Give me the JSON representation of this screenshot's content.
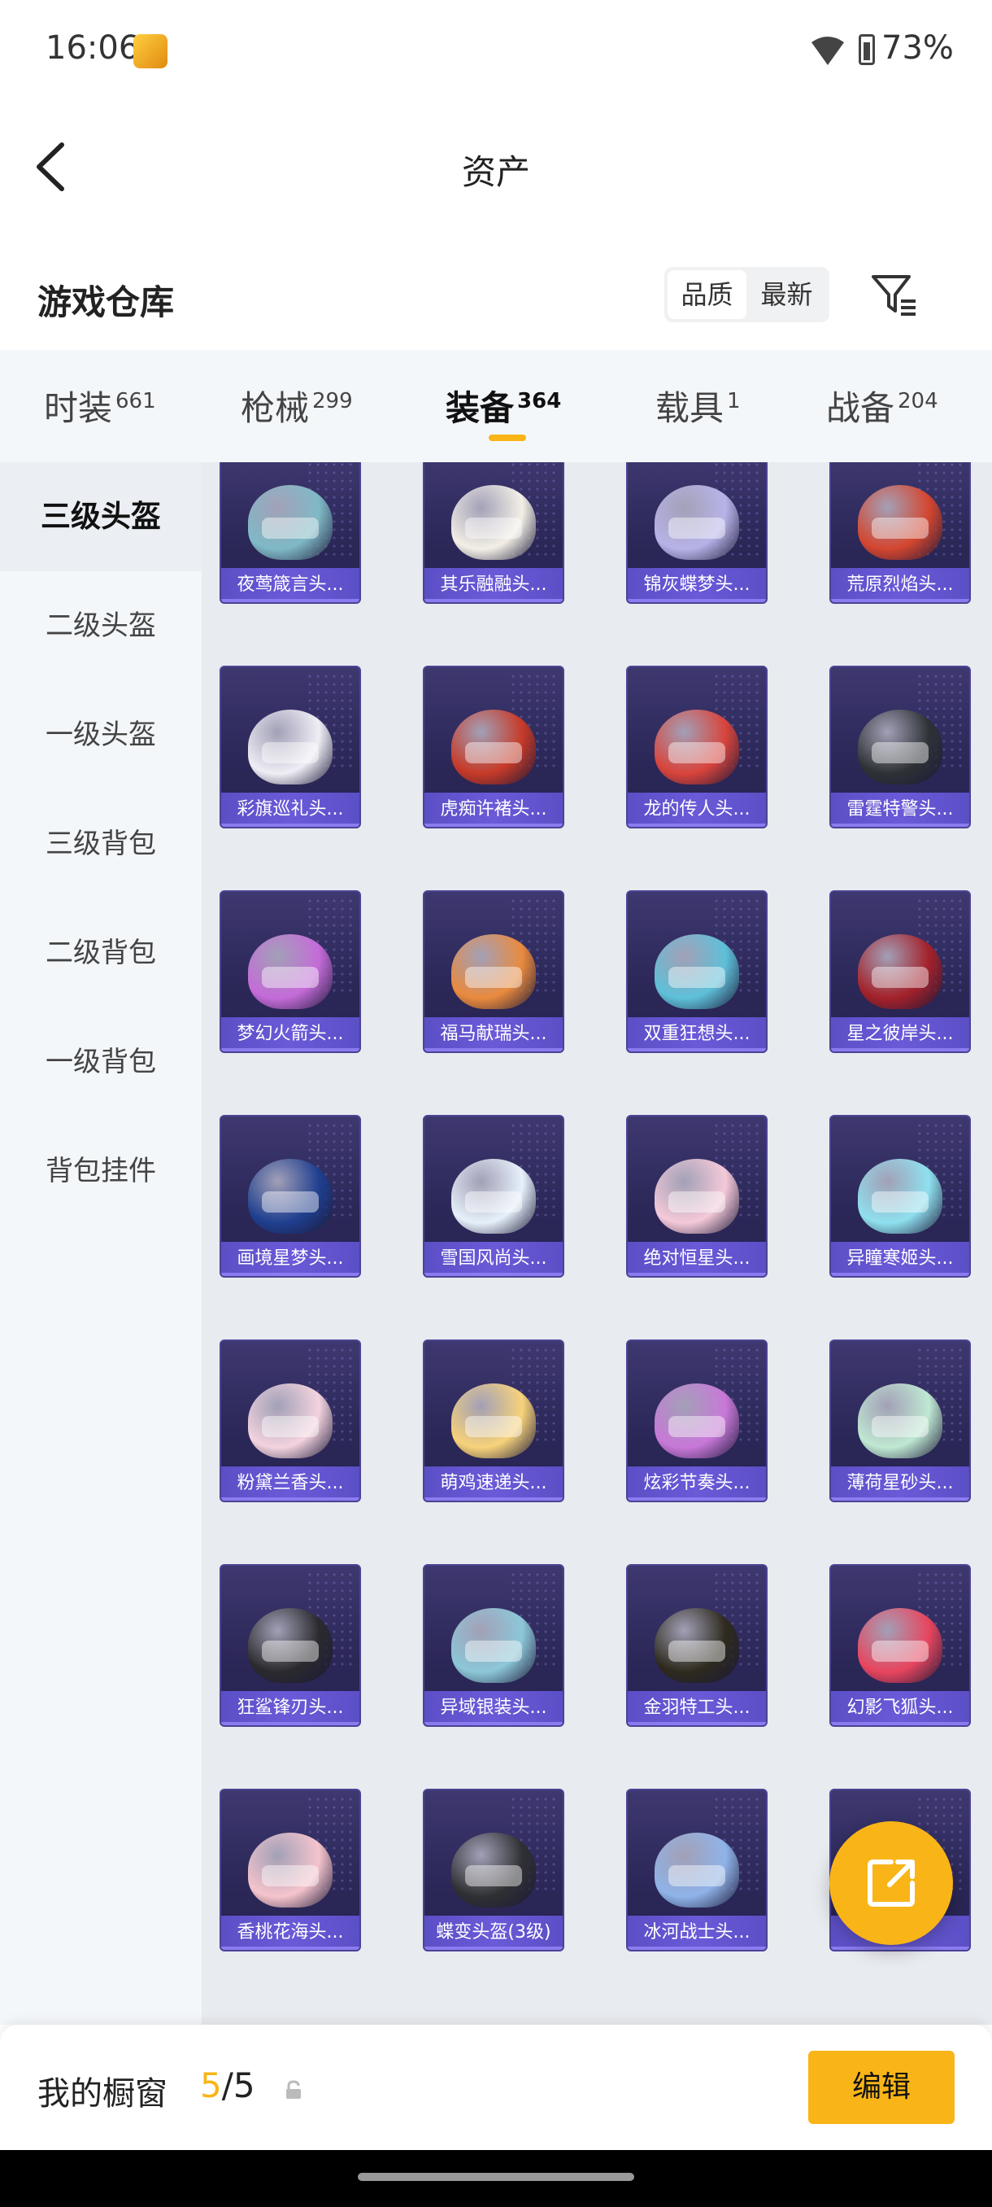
{
  "status_bar": {
    "time": "16:06",
    "battery": "73%"
  },
  "header": {
    "title": "资产"
  },
  "section": {
    "title": "游戏仓库",
    "sort_options": [
      "品质",
      "最新"
    ]
  },
  "tabs": [
    {
      "label": "时装",
      "count": "661"
    },
    {
      "label": "枪械",
      "count": "299"
    },
    {
      "label": "装备",
      "count": "364"
    },
    {
      "label": "载具",
      "count": "1"
    },
    {
      "label": "战备",
      "count": "204"
    }
  ],
  "sidebar": {
    "items": [
      "三级头盔",
      "二级头盔",
      "一级头盔",
      "三级背包",
      "二级背包",
      "一级背包",
      "背包挂件"
    ]
  },
  "items": [
    "夜莺箴言头...",
    "其乐融融头...",
    "锦灰蝶梦头...",
    "荒原烈焰头...",
    "彩旗巡礼头...",
    "虎痴许褚头...",
    "龙的传人头...",
    "雷霆特警头...",
    "梦幻火箭头...",
    "福马献瑞头...",
    "双重狂想头...",
    "星之彼岸头...",
    "画境星梦头...",
    "雪国风尚头...",
    "绝对恒星头...",
    "异瞳寒姬头...",
    "粉黛兰香头...",
    "萌鸡速递头...",
    "炫彩节奏头...",
    "薄荷星砂头...",
    "狂鲨锋刃头...",
    "异域银装头...",
    "金羽特工头...",
    "幻影飞狐头...",
    "香桃花海头...",
    "蝶变头盔(3级)",
    "冰河战士头...",
    "..."
  ],
  "helmet_colors": [
    "#7fb9c6",
    "#f3efe6",
    "#b7b3e8",
    "#d4462f",
    "#efeef5",
    "#c63a28",
    "#d8443c",
    "#2e3236",
    "#c46bd8",
    "#e98a3e",
    "#5ec0d8",
    "#a3212a",
    "#1f3f8f",
    "#e6f0fa",
    "#f4c9d8",
    "#8fe0ef",
    "#f3d3de",
    "#f7d27a",
    "#c878d8",
    "#bfe8d2",
    "#2a2a2e",
    "#8cc7d8",
    "#2e2a1e",
    "#e8455e",
    "#f5c4cc",
    "#2f3033",
    "#8fb3e8",
    "#8b3b25"
  ],
  "bottom_bar": {
    "label": "我的橱窗",
    "current": "5",
    "separator": "/",
    "total": "5",
    "edit_label": "编辑"
  },
  "accent_color": "#f9b517"
}
